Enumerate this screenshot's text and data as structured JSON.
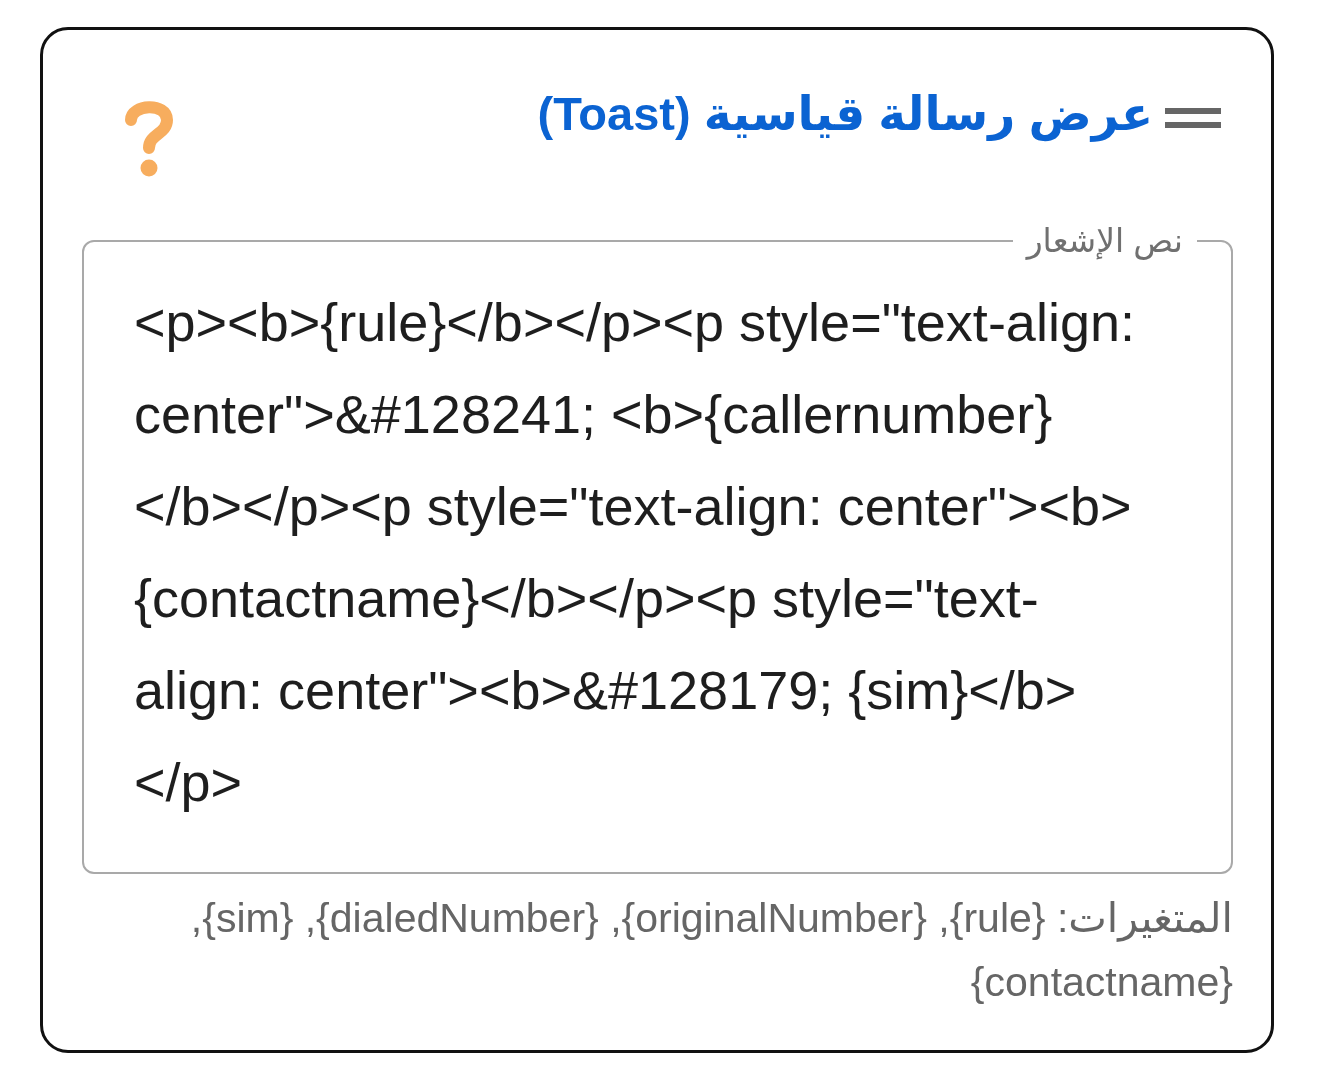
{
  "header": {
    "title": "عرض رسالة قياسية (Toast)"
  },
  "notification_text": {
    "label": "نص الإشعار",
    "value": "<p><b>{rule}</b></p><p style=\"text-align: center\">&#128241; <b>{callernumber}</b></p><p style=\"text-align: center\"><b>{contactname}</b></p><p style=\"text-align: center\"><b>&#128179; {sim}</b></p>"
  },
  "hint": "المتغيرات: {rule}, {originalNumber}, {dialedNumber}, {sim}, {contactname}"
}
